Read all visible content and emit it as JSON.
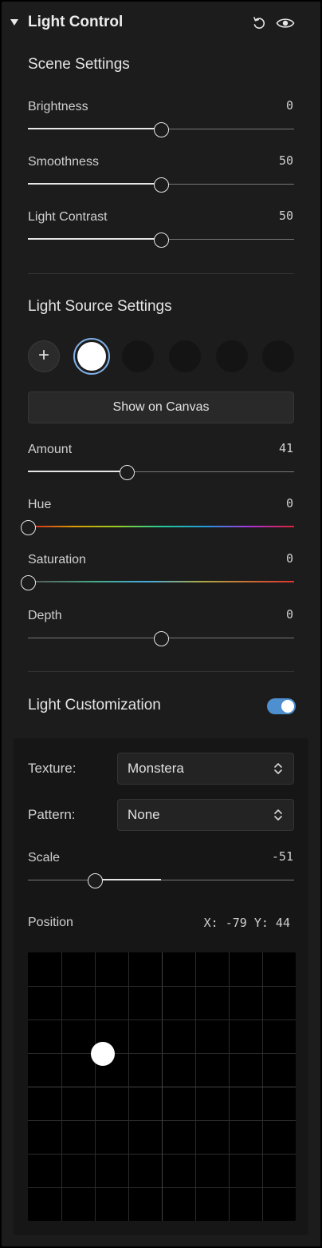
{
  "header": {
    "title": "Light Control",
    "reset_icon": "reset-icon",
    "visibility_icon": "eye-icon"
  },
  "scene": {
    "title": "Scene Settings",
    "brightness": {
      "label": "Brightness",
      "value": "0",
      "level": 0.5
    },
    "smoothness": {
      "label": "Smoothness",
      "value": "50",
      "level": 0.5
    },
    "contrast": {
      "label": "Light Contrast",
      "value": "50",
      "level": 0.5
    }
  },
  "source": {
    "title": "Light Source Settings",
    "add_label": "+",
    "show_canvas_label": "Show on Canvas",
    "amount": {
      "label": "Amount",
      "value": "41",
      "level": 0.37
    },
    "hue": {
      "label": "Hue",
      "value": "0",
      "level": 0
    },
    "saturation": {
      "label": "Saturation",
      "value": "0",
      "level": 0
    },
    "depth": {
      "label": "Depth",
      "value": "0",
      "level": 0.5
    }
  },
  "custom": {
    "title": "Light Customization",
    "enabled": true,
    "texture": {
      "label": "Texture:",
      "value": "Monstera"
    },
    "pattern": {
      "label": "Pattern:",
      "value": "None"
    },
    "scale": {
      "label": "Scale",
      "value": "-51",
      "level": 0.25
    },
    "position": {
      "label": "Position",
      "readout": "X: -79  Y: 44",
      "x": -79,
      "y": 44
    }
  },
  "colors": {
    "accent": "#4e8fd0",
    "panel": "#1c1c1c",
    "active_ring": "#7fb0e6"
  }
}
